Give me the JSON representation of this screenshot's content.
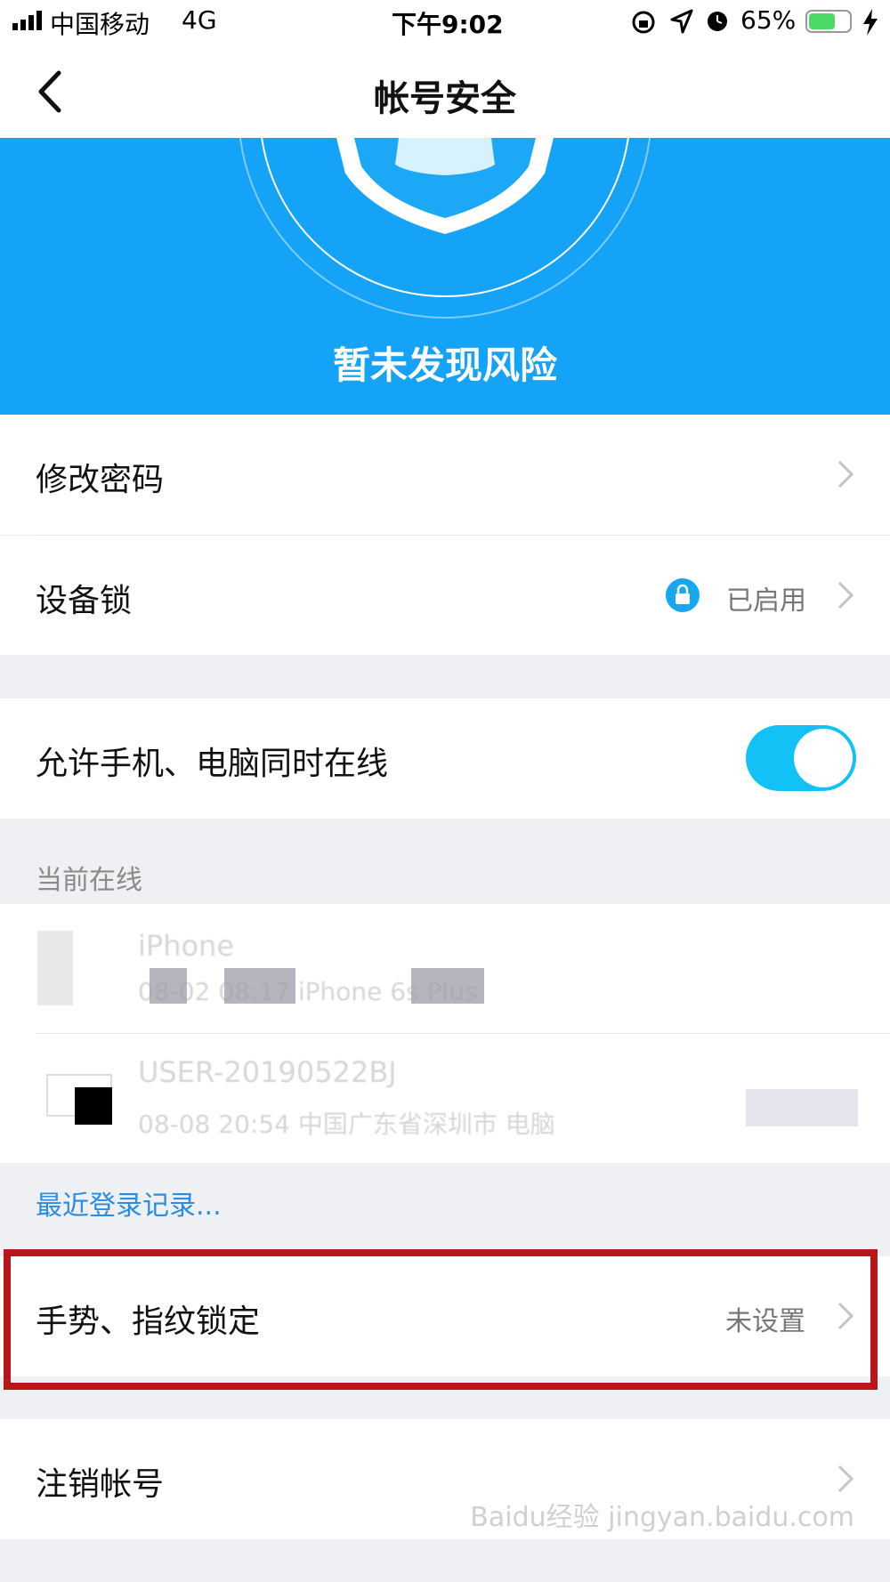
{
  "status_bar": {
    "carrier": "中国移动",
    "network": "4G",
    "time": "下午9:02",
    "battery_percent": "65%",
    "battery_level": 0.65,
    "battery_color": "#4cd964"
  },
  "nav": {
    "title": "帐号安全",
    "back_icon": "chevron-left-icon"
  },
  "hero": {
    "status_text": "暂未发现风险",
    "bg_color": "#15a3f8",
    "icon": "shield-icon"
  },
  "settings": {
    "change_password": {
      "label": "修改密码"
    },
    "device_lock": {
      "label": "设备锁",
      "value": "已启用",
      "icon": "lock-icon"
    },
    "multi_online": {
      "label": "允许手机、电脑同时在线",
      "enabled": true
    }
  },
  "online_section": {
    "header": "当前在线",
    "devices": [
      {
        "name": "iPhone",
        "detail": "08-02 08:17  iPhone 6s Plus",
        "icon": "phone-icon"
      },
      {
        "name": "USER-20190522BJ",
        "detail": "08-08 20:54 中国广东省深圳市 电脑",
        "icon": "computer-icon"
      }
    ]
  },
  "recent_login_link": "最近登录记录...",
  "gesture_lock": {
    "label": "手势、指纹锁定",
    "value": "未设置"
  },
  "deregister": {
    "label": "注销帐号"
  },
  "watermark": "Baidu经验 jingyan.baidu.com"
}
